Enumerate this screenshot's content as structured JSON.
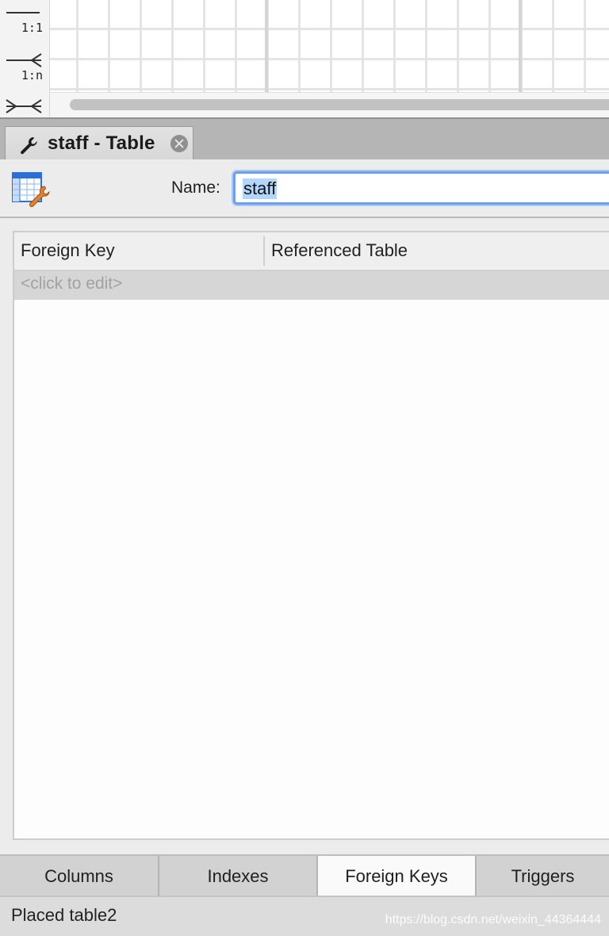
{
  "diagram": {
    "relationship_tools": [
      {
        "label": "1:1",
        "icon": "one-to-one-icon"
      },
      {
        "label": "1:n",
        "icon": "one-to-many-icon"
      },
      {
        "label": "",
        "icon": "many-to-many-icon"
      }
    ]
  },
  "editor": {
    "tab_title": "staff - Table",
    "name_label": "Name:",
    "name_value": "staff"
  },
  "foreign_keys": {
    "columns": [
      "Foreign Key",
      "Referenced Table"
    ],
    "placeholder_row": "<click to edit>"
  },
  "bottom_tabs": [
    {
      "label": "Columns",
      "active": false
    },
    {
      "label": "Indexes",
      "active": false
    },
    {
      "label": "Foreign Keys",
      "active": true
    },
    {
      "label": "Triggers",
      "active": false
    }
  ],
  "status": {
    "text": "Placed table2",
    "watermark": "https://blog.csdn.net/weixin_44364444"
  },
  "colors": {
    "selection": "#b3d6fe",
    "focus_ring": "#6f9fe7",
    "active_tab": "#fafafa"
  }
}
